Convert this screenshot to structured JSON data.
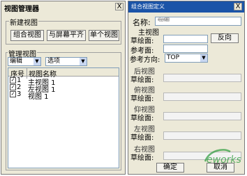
{
  "left_window": {
    "title": "视图管理器",
    "close_label": "X",
    "new_view_group": {
      "title": "新建视图",
      "buttons": [
        "组合视图",
        "与屏幕平齐",
        "单个视图"
      ]
    },
    "manage_group": {
      "title": "管理视图",
      "edit_combo": "编辑",
      "options_combo": "选项",
      "table_headers": [
        "序号",
        "视图名称"
      ],
      "rows": [
        {
          "num": "1",
          "name": "主视图 1",
          "checked": true
        },
        {
          "num": "2",
          "name": "左视图 1",
          "checked": true
        },
        {
          "num": "3",
          "name": "视图 1",
          "checked": true
        }
      ]
    }
  },
  "right_window": {
    "title": "组合视图定义",
    "close_label": "X",
    "name_label": "名称:",
    "name_value": "组合视图",
    "main_view": {
      "title": "主视图",
      "sketch_label": "草绘面:",
      "reverse_button": "反向",
      "reference_label": "参考面:"
    },
    "ref_direction_label": "参考方向:",
    "ref_direction_value": "TOP",
    "sub_views": [
      {
        "title": "后视图",
        "sketch_label": "草绘面:"
      },
      {
        "title": "俯视图",
        "sketch_label": "草绘面:"
      },
      {
        "title": "仰视图",
        "sketch_label": "草绘面:"
      },
      {
        "title": "左视图",
        "sketch_label": "草绘面:"
      },
      {
        "title": "右视图",
        "sketch_label": "草绘面:"
      }
    ],
    "ok_button": "确定",
    "cancel_button": "取消"
  },
  "watermark": "eworks",
  "colors": {
    "right_title_bar": "#1b54a8",
    "window_bg": "#ece9d8",
    "field_border": "#7f9db9",
    "watermark": "#2a9a3a"
  }
}
